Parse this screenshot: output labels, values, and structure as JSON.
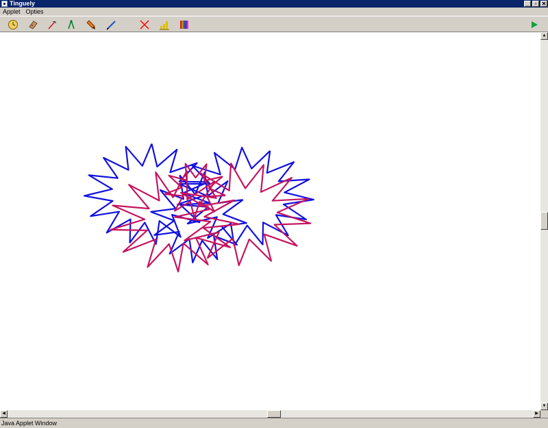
{
  "window": {
    "title": "Tinguely",
    "buttons": {
      "minimize": "_",
      "maximize": "▫",
      "close": "✕"
    }
  },
  "menu": {
    "items": [
      "Applet",
      "Opties"
    ]
  },
  "toolbar": {
    "tools": [
      {
        "icon": "clock-icon",
        "color": "#c8a000"
      },
      {
        "icon": "eraser-icon",
        "color": "#b07a4a"
      },
      {
        "icon": "hammer-icon",
        "color": "#cc2222"
      },
      {
        "icon": "compass-icon",
        "color": "#109040"
      },
      {
        "icon": "crayon-icon",
        "color": "#c06000"
      },
      {
        "icon": "pen-icon",
        "color": "#2050c0"
      },
      {
        "icon": "clear-x-icon",
        "color": "#ff0000"
      },
      {
        "icon": "bar-chart-icon",
        "color": "#e0c000"
      },
      {
        "icon": "color-palette-icon",
        "color": "#8040c0"
      },
      {
        "icon": "play-icon",
        "color": "#10a040"
      }
    ]
  },
  "canvas": {
    "stroke_colors": {
      "blue": "#1010e0",
      "magenta": "#c4145e"
    }
  },
  "status": {
    "text": "Java Applet Window"
  }
}
